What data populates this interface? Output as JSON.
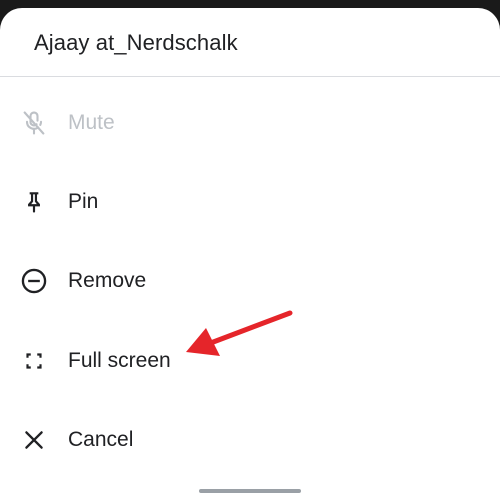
{
  "sheet": {
    "title": "Ajaay at_Nerdschalk"
  },
  "menu": {
    "items": [
      {
        "label": "Mute",
        "icon": "mic-off-icon",
        "enabled": false
      },
      {
        "label": "Pin",
        "icon": "pin-icon",
        "enabled": true
      },
      {
        "label": "Remove",
        "icon": "remove-circle-icon",
        "enabled": true
      },
      {
        "label": "Full screen",
        "icon": "fullscreen-icon",
        "enabled": true
      },
      {
        "label": "Cancel",
        "icon": "close-icon",
        "enabled": true
      }
    ]
  },
  "annotation": {
    "icon": "red-arrow-icon",
    "color": "#e5252a"
  },
  "colors": {
    "text": "#202124",
    "disabled_text": "#bdc1c6",
    "divider": "#dadce0"
  }
}
